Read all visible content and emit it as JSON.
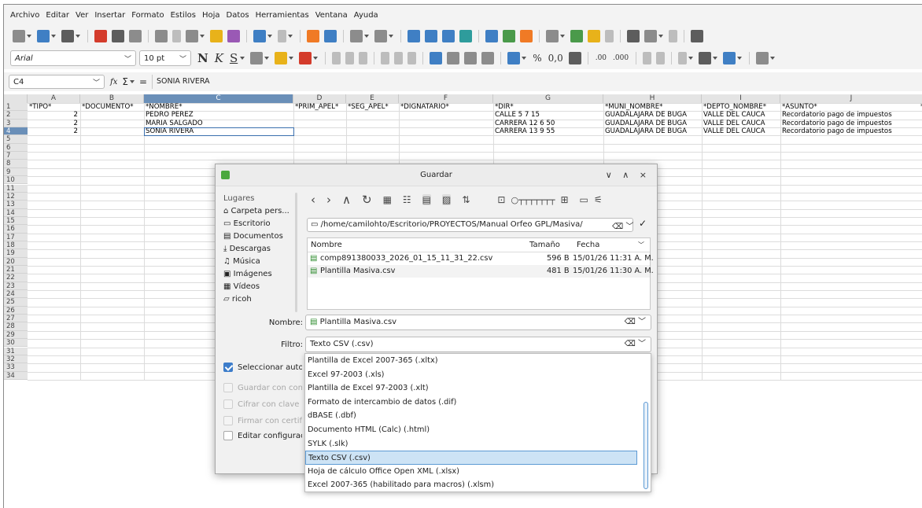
{
  "menu": [
    "Archivo",
    "Editar",
    "Ver",
    "Insertar",
    "Formato",
    "Estilos",
    "Hoja",
    "Datos",
    "Herramientas",
    "Ventana",
    "Ayuda"
  ],
  "toolbar": {
    "font_name": "Arial",
    "font_size": "10 pt",
    "bold": "N",
    "italic": "K",
    "underline": "S",
    "percent": "%",
    "decimal": "0,0",
    "dec_add": ".00",
    "dec_remove": ".000"
  },
  "formula_bar": {
    "cell_ref": "C4",
    "content": "SONIA RIVERA",
    "fx": "fx",
    "sum": "Σ",
    "eq": "="
  },
  "columns": [
    "A",
    "B",
    "C",
    "D",
    "E",
    "F",
    "G",
    "H",
    "I",
    "J"
  ],
  "headers": [
    "*TIPO*",
    "*DOCUMENTO*",
    "*NOMBRE*",
    "*PRIM_APEL*",
    "*SEG_APEL*",
    "*DIGNATARIO*",
    "*DIR*",
    "*MUNI_NOMBRE*",
    "*DEPTO_NOMBRE*",
    "*ASUNTO*",
    "*"
  ],
  "rows": [
    {
      "tipo": "2",
      "nombre": "PEDRO PÉREZ",
      "dir": "CALLE 5 7 15",
      "muni": "GUADALAJARA DE BUGA",
      "depto": "VALLE DEL CAUCA",
      "asunto": "Recordatorio pago de impuestos"
    },
    {
      "tipo": "2",
      "nombre": "MARÍA SALGADO",
      "dir": "CARRERA 12 6 50",
      "muni": "GUADALAJARA DE BUGA",
      "depto": "VALLE DEL CAUCA",
      "asunto": "Recordatorio pago de impuestos"
    },
    {
      "tipo": "2",
      "nombre": "SONIA RIVERA",
      "dir": "CARRERA 13 9 55",
      "muni": "GUADALAJARA DE BUGA",
      "depto": "VALLE DEL CAUCA",
      "asunto": "Recordatorio pago de impuestos"
    }
  ],
  "row_numbers": [
    "1",
    "2",
    "3",
    "4",
    "5",
    "6",
    "7",
    "8",
    "9",
    "10",
    "11",
    "12",
    "13",
    "14",
    "15",
    "16",
    "17",
    "18",
    "19",
    "20",
    "21",
    "22",
    "23",
    "24",
    "25",
    "26",
    "27",
    "28",
    "29",
    "30",
    "31",
    "32",
    "33",
    "34"
  ],
  "dialog": {
    "title": "Guardar",
    "places_title": "Lugares",
    "places": [
      "Carpeta pers...",
      "Escritorio",
      "Documentos",
      "Descargas",
      "Música",
      "Imágenes",
      "Vídeos",
      "ricoh"
    ],
    "path": "/home/camilohto/Escritorio/PROYECTOS/Manual Orfeo GPL/Masiva/",
    "list_headers": {
      "name": "Nombre",
      "size": "Tamaño",
      "date": "Fecha"
    },
    "files": [
      {
        "name": "comp891380033_2026_01_15_11_31_22.csv",
        "size": "596 B",
        "date": "15/01/26 11:31 A. M."
      },
      {
        "name": "Plantilla Masiva.csv",
        "size": "481 B",
        "date": "15/01/26 11:30 A. M."
      }
    ],
    "name_label": "Nombre:",
    "name_value": "Plantilla Masiva.csv",
    "filter_label": "Filtro:",
    "filter_value": "Texto CSV (.csv)",
    "options": [
      {
        "label": "Seleccionar automát",
        "checked": true,
        "disabled": false
      },
      {
        "label": "Guardar con contra",
        "checked": false,
        "disabled": true
      },
      {
        "label": "Cifrar con clave GP",
        "checked": false,
        "disabled": true
      },
      {
        "label": "Firmar con certifica",
        "checked": false,
        "disabled": true
      },
      {
        "label": "Editar configuració",
        "checked": false,
        "disabled": false
      }
    ],
    "filter_options": [
      "Plantilla de Excel 2007-365 (.xltx)",
      "Excel 97-2003 (.xls)",
      "Plantilla de Excel 97-2003 (.xlt)",
      "Formato de intercambio de datos (.dif)",
      "dBASE (.dbf)",
      "Documento HTML (Calc) (.html)",
      "SYLK (.slk)",
      "Texto CSV (.csv)",
      "Hoja de cálculo Office Open XML (.xlsx)",
      "Excel 2007-365 (habilitado para macros) (.xlsm)"
    ],
    "selected_filter_index": 7
  }
}
